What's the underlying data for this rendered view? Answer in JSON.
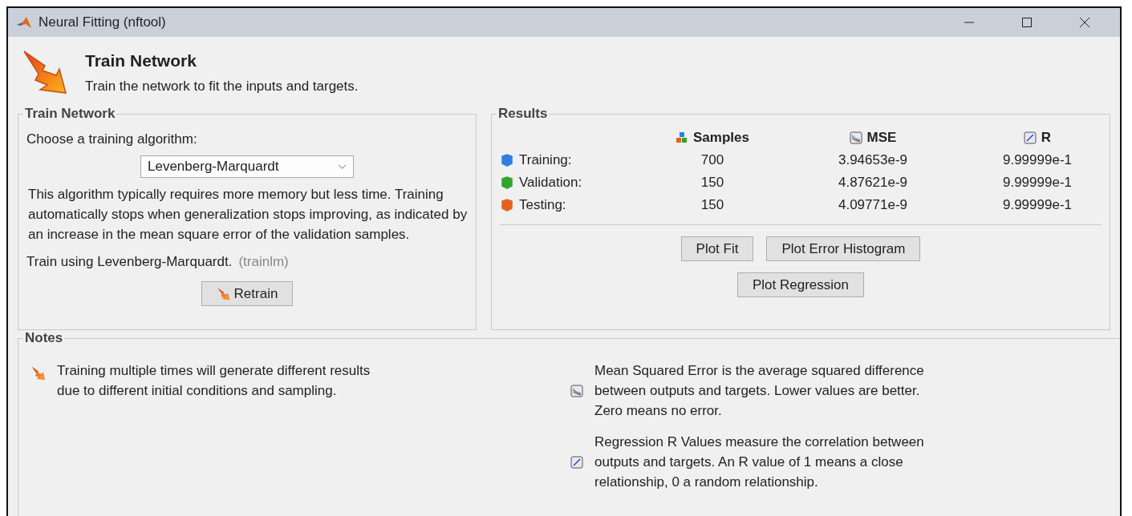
{
  "window": {
    "title": "Neural Fitting (nftool)"
  },
  "header": {
    "title": "Train Network",
    "subtitle": "Train the network to fit the inputs and targets."
  },
  "train_panel": {
    "title": "Train Network",
    "prompt": "Choose a training algorithm:",
    "algorithm": "Levenberg-Marquardt",
    "description": [
      "This algorithm typically requires more memory but less time. Training",
      "automatically stops when generalization stops improving, as indicated by",
      "an increase in the mean square error of the validation samples."
    ],
    "train_using": "Train using Levenberg-Marquardt.",
    "function_name": "(trainlm)",
    "retrain_button": "Retrain"
  },
  "results_panel": {
    "title": "Results",
    "columns": [
      "Samples",
      "MSE",
      "R"
    ],
    "rows": [
      {
        "label": "Training:",
        "color": "#2f7fe0",
        "samples": "700",
        "mse": "3.94653e-9",
        "r": "9.99999e-1"
      },
      {
        "label": "Validation:",
        "color": "#2fa52a",
        "samples": "150",
        "mse": "4.87621e-9",
        "r": "9.99999e-1"
      },
      {
        "label": "Testing:",
        "color": "#e2641c",
        "samples": "150",
        "mse": "4.09771e-9",
        "r": "9.99999e-1"
      }
    ],
    "buttons": [
      "Plot Fit",
      "Plot Error Histogram",
      "Plot Regression"
    ]
  },
  "notes_panel": {
    "title": "Notes",
    "notes": [
      {
        "kind": "train",
        "lines": [
          "Training multiple times will generate different results",
          "due to different initial conditions and sampling."
        ]
      },
      {
        "kind": "mse",
        "lines": [
          "Mean Squared Error is the average squared difference",
          "between outputs and targets. Lower values are better.",
          "Zero means no error."
        ]
      },
      {
        "kind": "r",
        "lines": [
          "Regression R Values measure the correlation between",
          "outputs and targets. An R value of 1 means a close",
          "relationship, 0 a random relationship."
        ]
      }
    ]
  }
}
